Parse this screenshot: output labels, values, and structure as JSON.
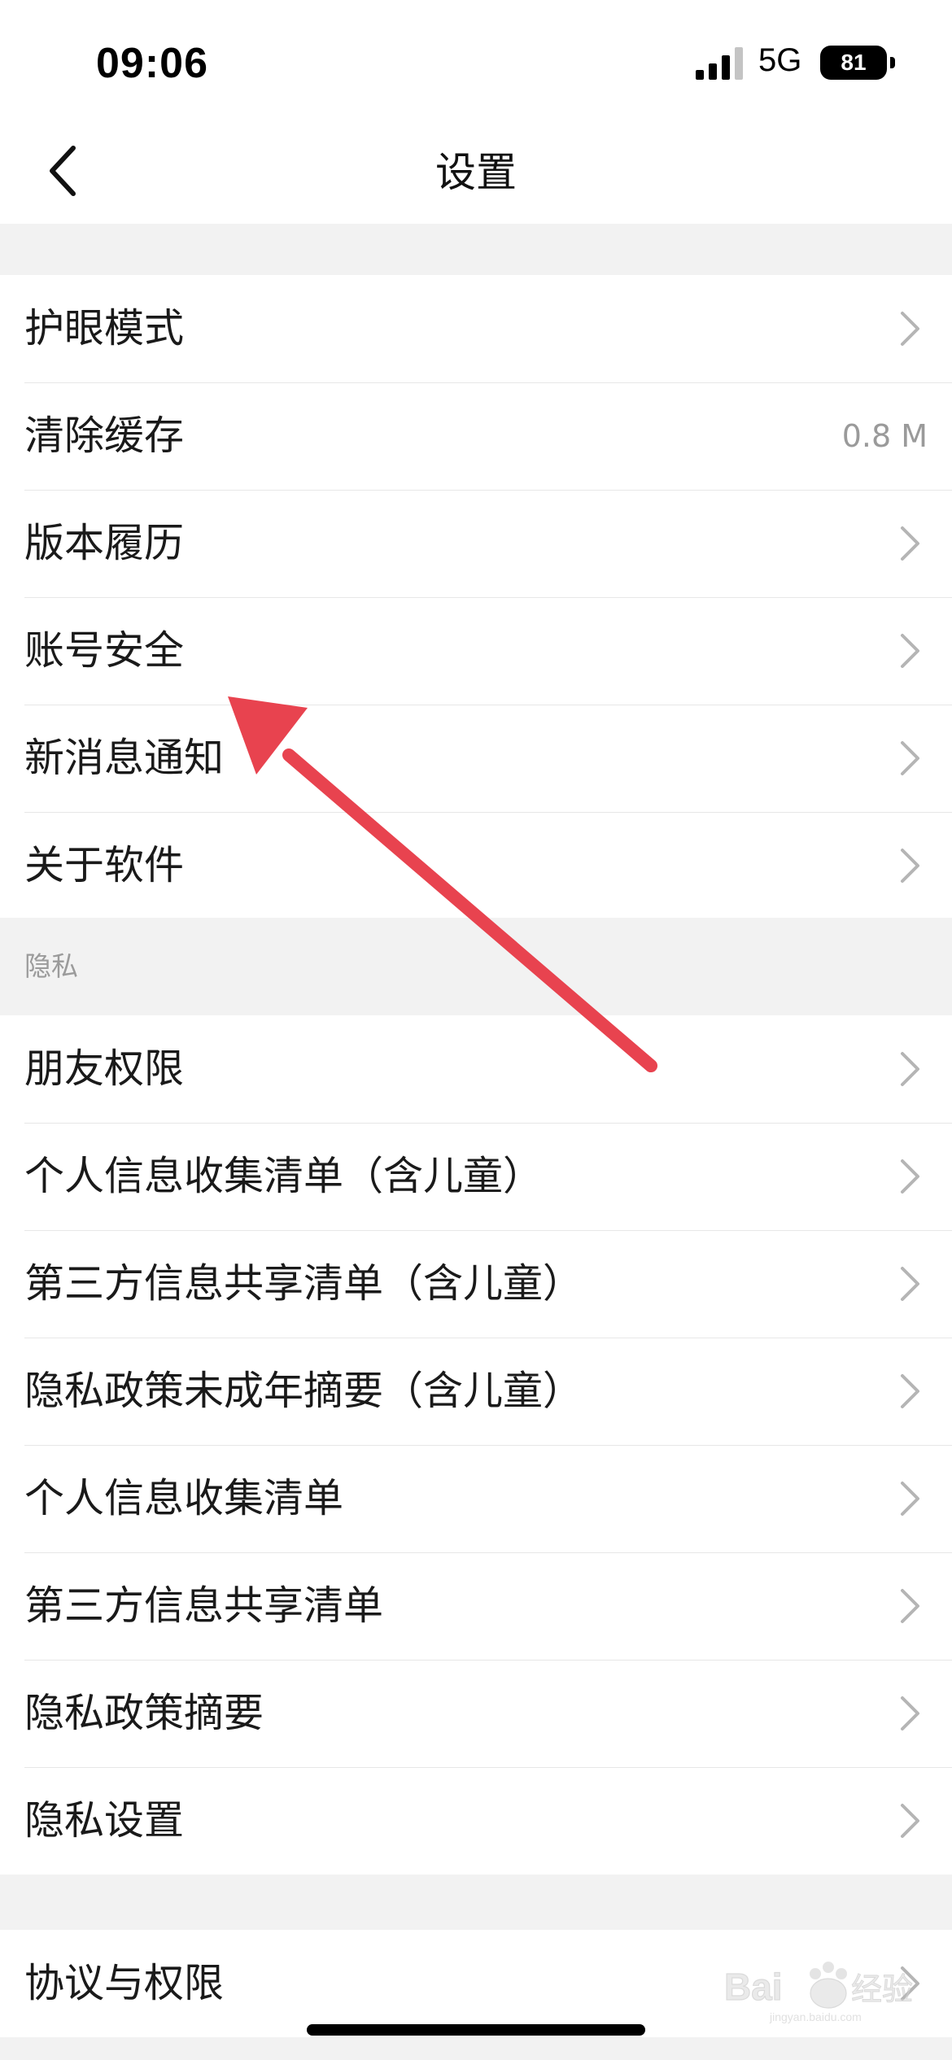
{
  "status_bar": {
    "time": "09:06",
    "network": "5G",
    "battery": "81",
    "signal_icon": "cellular-signal-icon"
  },
  "nav": {
    "title": "设置",
    "back_icon": "chevron-left-icon"
  },
  "general_items": [
    {
      "label": "护眼模式",
      "accessory": "chevron"
    },
    {
      "label": "清除缓存",
      "value": "0.8 M"
    },
    {
      "label": "版本履历",
      "accessory": "chevron"
    },
    {
      "label": "账号安全",
      "accessory": "chevron"
    },
    {
      "label": "新消息通知",
      "accessory": "chevron"
    },
    {
      "label": "关于软件",
      "accessory": "chevron"
    }
  ],
  "privacy_section": {
    "header": "隐私",
    "items": [
      {
        "label": "朋友权限"
      },
      {
        "label": "个人信息收集清单（含儿童）"
      },
      {
        "label": "第三方信息共享清单（含儿童）"
      },
      {
        "label": "隐私政策未成年摘要（含儿童）"
      },
      {
        "label": "个人信息收集清单"
      },
      {
        "label": "第三方信息共享清单"
      },
      {
        "label": "隐私政策摘要"
      },
      {
        "label": "隐私设置"
      }
    ]
  },
  "agreement_items": [
    {
      "label": "协议与权限"
    }
  ],
  "annotation": {
    "arrow_color": "#e8434f",
    "target": "账号安全"
  },
  "watermark": {
    "brand": "Baidu经验",
    "domain": "jingyan.baidu.com"
  },
  "colors": {
    "background": "#f2f2f2",
    "text": "#1a1a1a",
    "secondary_text": "#9a9a9a",
    "chevron": "#b5b5b5"
  }
}
